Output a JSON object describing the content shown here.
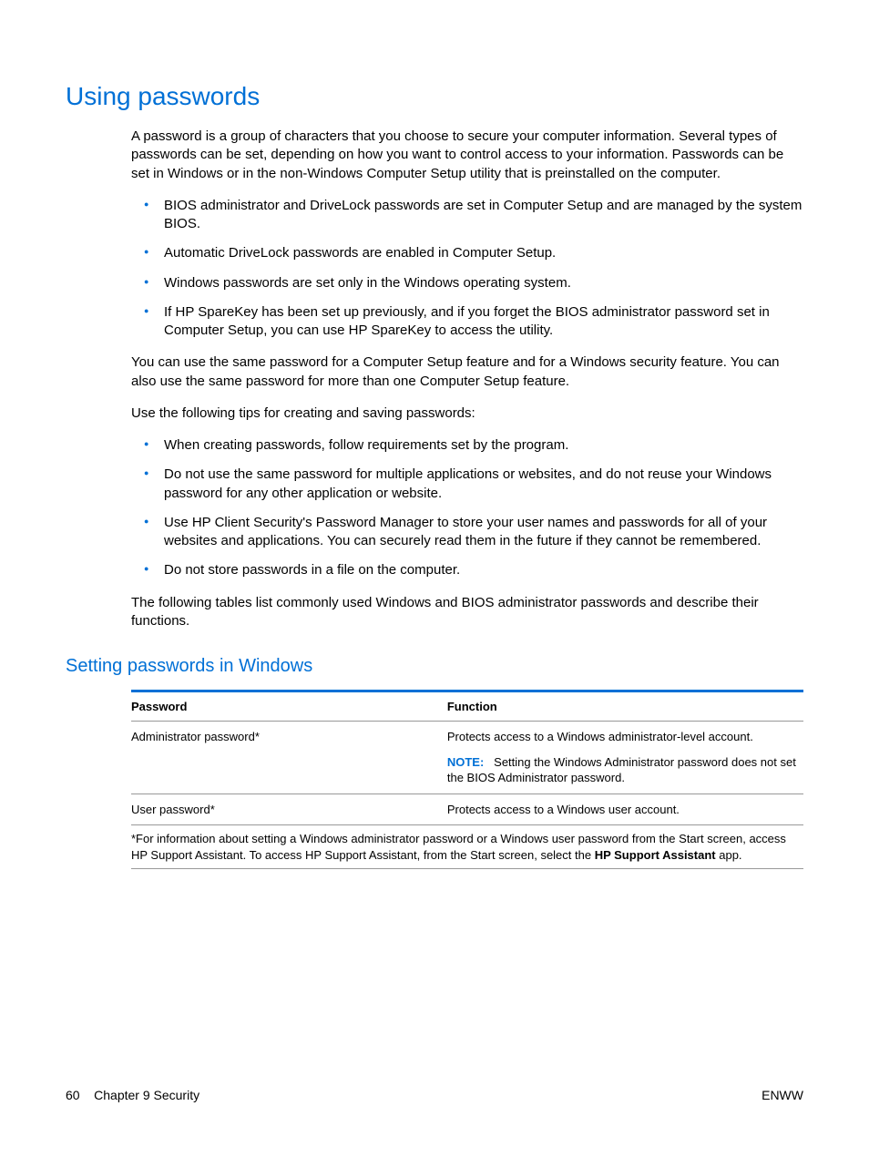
{
  "heading": "Using passwords",
  "intro_para": "A password is a group of characters that you choose to secure your computer information. Several types of passwords can be set, depending on how you want to control access to your information. Passwords can be set in Windows or in the non-Windows Computer Setup utility that is preinstalled on the computer.",
  "bullets1": [
    "BIOS administrator and DriveLock passwords are set in Computer Setup and are managed by the system BIOS.",
    "Automatic DriveLock passwords are enabled in Computer Setup.",
    "Windows passwords are set only in the Windows operating system.",
    "If HP SpareKey has been set up previously, and if you forget the BIOS administrator password set in Computer Setup, you can use HP SpareKey to access the utility."
  ],
  "mid_para1": "You can use the same password for a Computer Setup feature and for a Windows security feature. You can also use the same password for more than one Computer Setup feature.",
  "mid_para2": "Use the following tips for creating and saving passwords:",
  "bullets2": [
    "When creating passwords, follow requirements set by the program.",
    "Do not use the same password for multiple applications or websites, and do not reuse your Windows password for any other application or website.",
    "Use HP Client Security's Password Manager to store your user names and passwords for all of your websites and applications. You can securely read them in the future if they cannot be remembered.",
    "Do not store passwords in a file on the computer."
  ],
  "closing_para": "The following tables list commonly used Windows and BIOS administrator passwords and describe their functions.",
  "subheading": "Setting passwords in Windows",
  "table": {
    "header": {
      "col1": "Password",
      "col2": "Function"
    },
    "rows": [
      {
        "password": "Administrator password*",
        "function": "Protects access to a Windows administrator-level account.",
        "note_label": "NOTE:",
        "note_text": "Setting the Windows Administrator password does not set the BIOS Administrator password."
      },
      {
        "password": "User password*",
        "function": "Protects access to a Windows user account."
      }
    ],
    "footnote_pre": "*For information about setting a Windows administrator password or a Windows user password from the Start screen, access HP Support Assistant. To access HP Support Assistant, from the Start screen, select the ",
    "footnote_bold": "HP Support Assistant",
    "footnote_post": " app."
  },
  "footer": {
    "page_number": "60",
    "chapter": "Chapter 9   Security",
    "right": "ENWW"
  }
}
